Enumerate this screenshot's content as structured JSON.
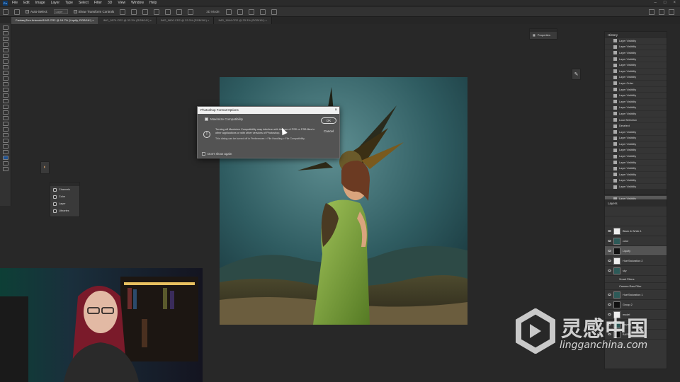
{
  "menubar": {
    "logo": "Ps",
    "items": [
      "File",
      "Edit",
      "Image",
      "Layer",
      "Type",
      "Select",
      "Filter",
      "3D",
      "View",
      "Window",
      "Help"
    ]
  },
  "options_bar": {
    "auto_select_label": "Auto-Select:",
    "auto_select_value": "Layer",
    "transform_controls_label": "Show Transform Controls",
    "mode_3d_label": "3D Mode:"
  },
  "doc_tabs": [
    "FantasyTom Artwork#1042.CR2 @ 16.7% (Liquify, RGB/16*) ×",
    "IMG_9574.CR2 @ 33.3% (RGB/16*) ×",
    "IMG_9600.CR2 @ 33.3% (RGB/16*) ×",
    "IMG_1844.CR2 @ 33.3% (RGB/16*) ×"
  ],
  "dialog": {
    "title": "Photoshop Format Options",
    "checkbox_label": "Maximize Compatibility",
    "body": "Turning off Maximize Compatibility may interfere with the use of PSD or PSB files in other applications or with other versions of Photoshop.",
    "note": "This dialog can be turned off in Preferences > File Handling > File Compatibility.",
    "dont_show": "Don't show again",
    "ok": "OK",
    "cancel": "Cancel"
  },
  "properties_panel": {
    "label": "Properties"
  },
  "float_panel": {
    "items": [
      "Channels",
      "Color",
      "Layer",
      "Libraries"
    ]
  },
  "history": {
    "title": "History",
    "rows": [
      "Layer Visibility",
      "Layer Visibility",
      "Layer Visibility",
      "Layer Visibility",
      "Layer Visibility",
      "Layer Visibility",
      "Layer Visibility",
      "Layer Order",
      "Layer Visibility",
      "Layer Visibility",
      "Layer Visibility",
      "Layer Visibility",
      "Layer Visibility",
      "Load Selection",
      "Deselect",
      "Layer Visibility",
      "Layer Visibility",
      "Layer Visibility",
      "Layer Visibility",
      "Layer Visibility",
      "Layer Visibility",
      "Layer Visibility",
      "Layer Visibility",
      "Layer Visibility",
      "Layer Visibility",
      "Name Change",
      "Layer Visibility"
    ]
  },
  "layers": {
    "title": "Layers",
    "rows": [
      {
        "name": "Black & White 1",
        "sub": false,
        "active": false
      },
      {
        "name": "color",
        "sub": false,
        "active": false
      },
      {
        "name": "Liquify",
        "sub": false,
        "active": true
      },
      {
        "name": "Hue/Saturation 2",
        "sub": false,
        "active": false
      },
      {
        "name": "sky",
        "sub": false,
        "active": false
      },
      {
        "name": "Smart Filters",
        "sub": true,
        "active": false
      },
      {
        "name": "Camera Raw Filter",
        "sub": true,
        "active": false
      },
      {
        "name": "Hue/Saturation 1",
        "sub": false,
        "active": false
      },
      {
        "name": "Group 2",
        "sub": false,
        "active": false
      },
      {
        "name": "model",
        "sub": false,
        "active": false
      },
      {
        "name": "Layer 1",
        "sub": false,
        "active": false
      },
      {
        "name": "BASE",
        "sub": false,
        "active": false
      }
    ]
  },
  "watermark": {
    "cn": "灵感中国",
    "en": "lingganchina.com"
  },
  "colors": {
    "workspace": "#282828",
    "panel": "#353535",
    "accent_sky": "#3a6468"
  }
}
